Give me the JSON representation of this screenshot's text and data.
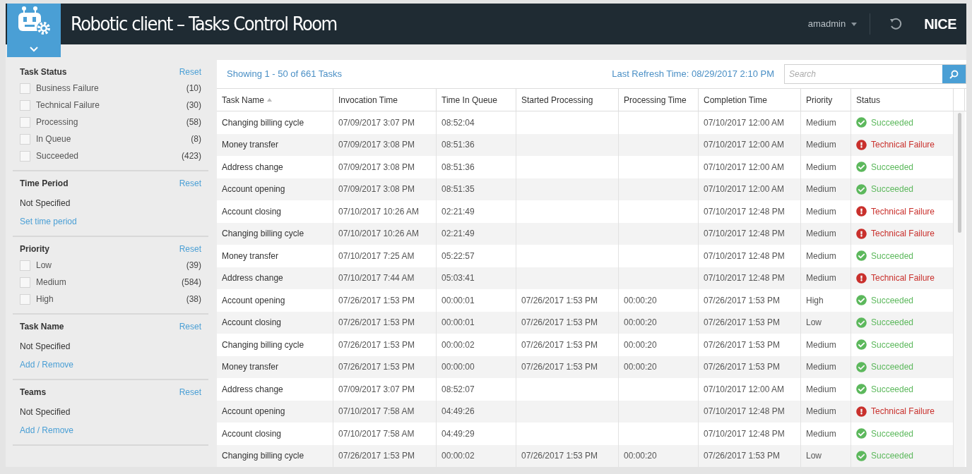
{
  "header": {
    "title": "Robotic client – Tasks Control Room",
    "user": "amadmin",
    "brand": "NICE"
  },
  "filters": [
    {
      "kind": "checklist",
      "title": "Task Status",
      "reset": "Reset",
      "options": [
        {
          "label": "Business Failure",
          "count": "(10)",
          "checked": false
        },
        {
          "label": "Technical Failure",
          "count": "(30)",
          "checked": false
        },
        {
          "label": "Processing",
          "count": "(58)",
          "checked": false
        },
        {
          "label": "In Queue",
          "count": "(8)",
          "checked": false
        },
        {
          "label": "Succeeded",
          "count": "(423)",
          "checked": false
        }
      ]
    },
    {
      "kind": "value",
      "title": "Time Period",
      "reset": "Reset",
      "value": "Not Specified",
      "link": "Set time period"
    },
    {
      "kind": "checklist",
      "title": "Priority",
      "reset": "Reset",
      "options": [
        {
          "label": "Low",
          "count": "(39)",
          "checked": false
        },
        {
          "label": "Medium",
          "count": "(584)",
          "checked": false
        },
        {
          "label": "High",
          "count": "(38)",
          "checked": false
        }
      ]
    },
    {
      "kind": "value",
      "title": "Task Name",
      "reset": "Reset",
      "value": "Not Specified",
      "link": "Add / Remove"
    },
    {
      "kind": "value",
      "title": "Teams",
      "reset": "Reset",
      "value": "Not Specified",
      "link": "Add / Remove"
    }
  ],
  "summary": "Showing 1 - 50 of 661 Tasks",
  "last_refresh": "Last Refresh Time: 08/29/2017 2:10 PM",
  "search": {
    "placeholder": "Search"
  },
  "table": {
    "columns": [
      "Task Name",
      "Invocation Time",
      "Time In Queue",
      "Started Processing",
      "Processing Time",
      "Completion Time",
      "Priority",
      "Status"
    ],
    "rows": [
      [
        "Changing billing cycle",
        "07/09/2017 3:07 PM",
        "08:52:04",
        "",
        "",
        "07/10/2017 12:00 AM",
        "Medium",
        {
          "kind": "success",
          "text": "Succeeded"
        }
      ],
      [
        "Money transfer",
        "07/09/2017 3:08 PM",
        "08:51:36",
        "",
        "",
        "07/10/2017 12:00 AM",
        "Medium",
        {
          "kind": "failure",
          "text": "Technical Failure"
        }
      ],
      [
        "Address change",
        "07/09/2017 3:08 PM",
        "08:51:36",
        "",
        "",
        "07/10/2017 12:00 AM",
        "Medium",
        {
          "kind": "success",
          "text": "Succeeded"
        }
      ],
      [
        "Account opening",
        "07/09/2017 3:08 PM",
        "08:51:35",
        "",
        "",
        "07/10/2017 12:00 AM",
        "Medium",
        {
          "kind": "success",
          "text": "Succeeded"
        }
      ],
      [
        "Account closing",
        "07/10/2017 10:26 AM",
        "02:21:49",
        "",
        "",
        "07/10/2017 12:48 PM",
        "Medium",
        {
          "kind": "failure",
          "text": "Technical Failure"
        }
      ],
      [
        "Changing billing cycle",
        "07/10/2017 10:26 AM",
        "02:21:49",
        "",
        "",
        "07/10/2017 12:48 PM",
        "Medium",
        {
          "kind": "failure",
          "text": "Technical Failure"
        }
      ],
      [
        "Money transfer",
        "07/10/2017 7:25 AM",
        "05:22:57",
        "",
        "",
        "07/10/2017 12:48 PM",
        "Medium",
        {
          "kind": "success",
          "text": "Succeeded"
        }
      ],
      [
        "Address change",
        "07/10/2017 7:44 AM",
        "05:03:41",
        "",
        "",
        "07/10/2017 12:48 PM",
        "Medium",
        {
          "kind": "failure",
          "text": "Technical Failure"
        }
      ],
      [
        "Account opening",
        "07/26/2017 1:53 PM",
        "00:00:01",
        "07/26/2017 1:53 PM",
        "00:00:20",
        "07/26/2017 1:53 PM",
        "High",
        {
          "kind": "success",
          "text": "Succeeded"
        }
      ],
      [
        "Account closing",
        "07/26/2017 1:53 PM",
        "00:00:01",
        "07/26/2017 1:53 PM",
        "00:00:20",
        "07/26/2017 1:53 PM",
        "Low",
        {
          "kind": "success",
          "text": "Succeeded"
        }
      ],
      [
        "Changing billing cycle",
        "07/26/2017 1:53 PM",
        "00:00:02",
        "07/26/2017 1:53 PM",
        "00:00:20",
        "07/26/2017 1:53 PM",
        "Medium",
        {
          "kind": "success",
          "text": "Succeeded"
        }
      ],
      [
        "Money transfer",
        "07/26/2017 1:53 PM",
        "00:00:00",
        "07/26/2017 1:53 PM",
        "00:00:20",
        "07/26/2017 1:53 PM",
        "Medium",
        {
          "kind": "success",
          "text": "Succeeded"
        }
      ],
      [
        "Address change",
        "07/09/2017 3:07 PM",
        "08:52:07",
        "",
        "",
        "07/10/2017 12:00 AM",
        "Medium",
        {
          "kind": "success",
          "text": "Succeeded"
        }
      ],
      [
        "Account opening",
        "07/10/2017 7:58 AM",
        "04:49:26",
        "",
        "",
        "07/10/2017 12:48 PM",
        "Medium",
        {
          "kind": "failure",
          "text": "Technical Failure"
        }
      ],
      [
        "Account closing",
        "07/10/2017 7:58 AM",
        "04:49:29",
        "",
        "",
        "07/10/2017 12:48 PM",
        "Medium",
        {
          "kind": "success",
          "text": "Succeeded"
        }
      ],
      [
        "Changing billing cycle",
        "07/26/2017 1:53 PM",
        "00:00:02",
        "07/26/2017 1:53 PM",
        "00:00:20",
        "07/26/2017 1:53 PM",
        "Low",
        {
          "kind": "success",
          "text": "Succeeded"
        }
      ]
    ]
  }
}
